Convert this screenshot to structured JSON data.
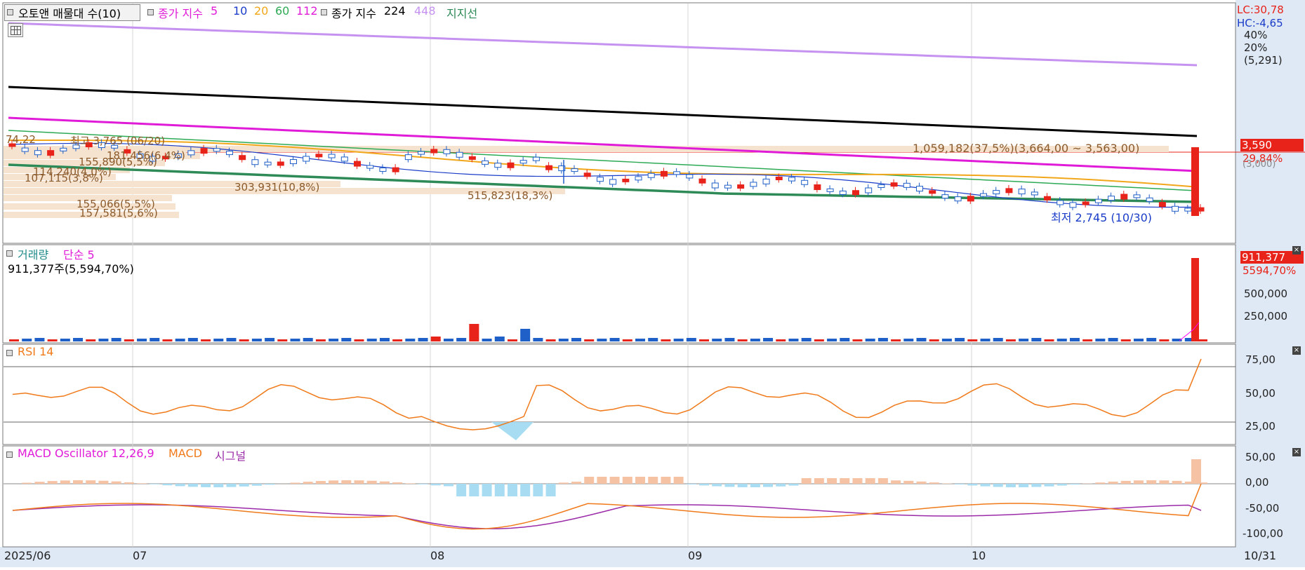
{
  "header": {
    "title_button": "오토앤 매물대 수(10)",
    "legend_line1": "종가 지수",
    "ma_values": [
      "5",
      "10",
      "20",
      "60",
      "112"
    ],
    "legend_line2": "종가 지수",
    "ma_long": [
      "224",
      "448"
    ],
    "support_label": "지지선"
  },
  "right_axis_top": {
    "lc": "LC:30,78",
    "hc": "HC:-4,65",
    "pct40": "40%",
    "pct20": "20%",
    "paren_price": "(5,291)",
    "current_price": "3,590",
    "current_pct": "29,84%",
    "paren_prev": "(3,000)"
  },
  "price_annotations": {
    "high_label": "최고 3,765 (06/20)",
    "high_prefix": "74,22",
    "low_label": "최저 2,745 (10/30)",
    "vp_top": "1,059,182(37,5%)(3,664,00 ~ 3,563,00)",
    "vp_labels": [
      "181,456(6,4%)",
      "155,890(5,5%)",
      "114,240(4,0%)",
      "107,115(3,8%)",
      "303,931(10,8%)",
      "515,823(18,3%)",
      "155,066(5,5%)",
      "157,581(5,6%)"
    ]
  },
  "volume": {
    "title": "거래량",
    "ma": "단순 5",
    "value": "911,377주(5,594,70%)",
    "current": "911,377",
    "current_pct": "5594,70%",
    "ticks": [
      "500,000",
      "250,000"
    ]
  },
  "rsi": {
    "title": "RSI 14",
    "ticks": [
      "75,00",
      "50,00",
      "25,00"
    ]
  },
  "macd": {
    "title": "MACD Oscillator 12,26,9",
    "macd": "MACD",
    "signal": "시그널",
    "ticks": [
      "50,00",
      "0,00",
      "-50,00",
      "-100,00"
    ]
  },
  "xaxis": {
    "labels": [
      "2025/06",
      "07",
      "08",
      "09",
      "10"
    ],
    "right": "10/31"
  },
  "colors": {
    "up": "#e8231a",
    "down": "#1f5fc8",
    "ma5": "#ff00ff",
    "ma10": "#1a3cc8",
    "ma20": "#f2a71b",
    "ma60": "#2eaa55",
    "ma112": "#e01bd8",
    "ma224": "#000000",
    "ma448": "#c592f0",
    "support": "#2e8b57",
    "volume_profile": "#f5e3cf",
    "rsi": "#f07a1a",
    "macd_line": "#f07a1a",
    "signal_line": "#9b2aa8",
    "osc_pos": "#f6c2a4",
    "osc_neg": "#a7dcf2"
  }
}
